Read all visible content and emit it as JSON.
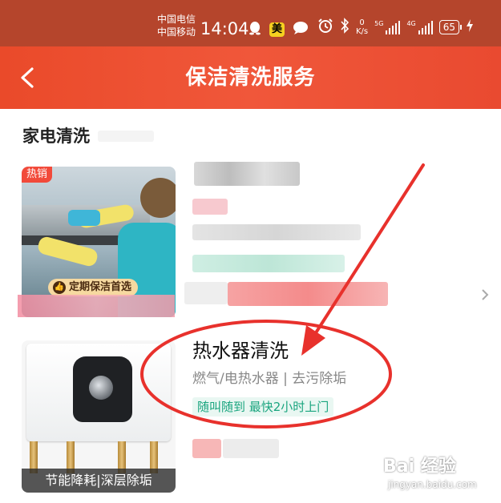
{
  "status_bar": {
    "carrier_1": "中国电信",
    "carrier_2": "中国移动",
    "time": "14:04",
    "mei_label": "美",
    "net_speed_value": "0",
    "net_speed_unit": "K/s",
    "sig1_label": "5G",
    "sig2_label": "4G",
    "battery": "65"
  },
  "navbar": {
    "title": "保洁清洗服务"
  },
  "section": {
    "title": "家电清洗"
  },
  "card_1": {
    "hot_badge": "热销",
    "promo_badge": "定期保洁首选"
  },
  "card_2": {
    "image_caption": "节能降耗|深层除垢",
    "title": "热水器清洗",
    "subtitle": "燃气/电热水器 | 去污除垢",
    "tag": "随叫随到 最快2小时上门"
  },
  "watermark": {
    "brand": "Bai 经验",
    "domain": "jingyan.baidu.com"
  },
  "colors": {
    "navbar": "#ea4a2a",
    "status_bar": "#b5452c",
    "tag_text": "#1aa57f",
    "annotation": "#e8312c"
  }
}
